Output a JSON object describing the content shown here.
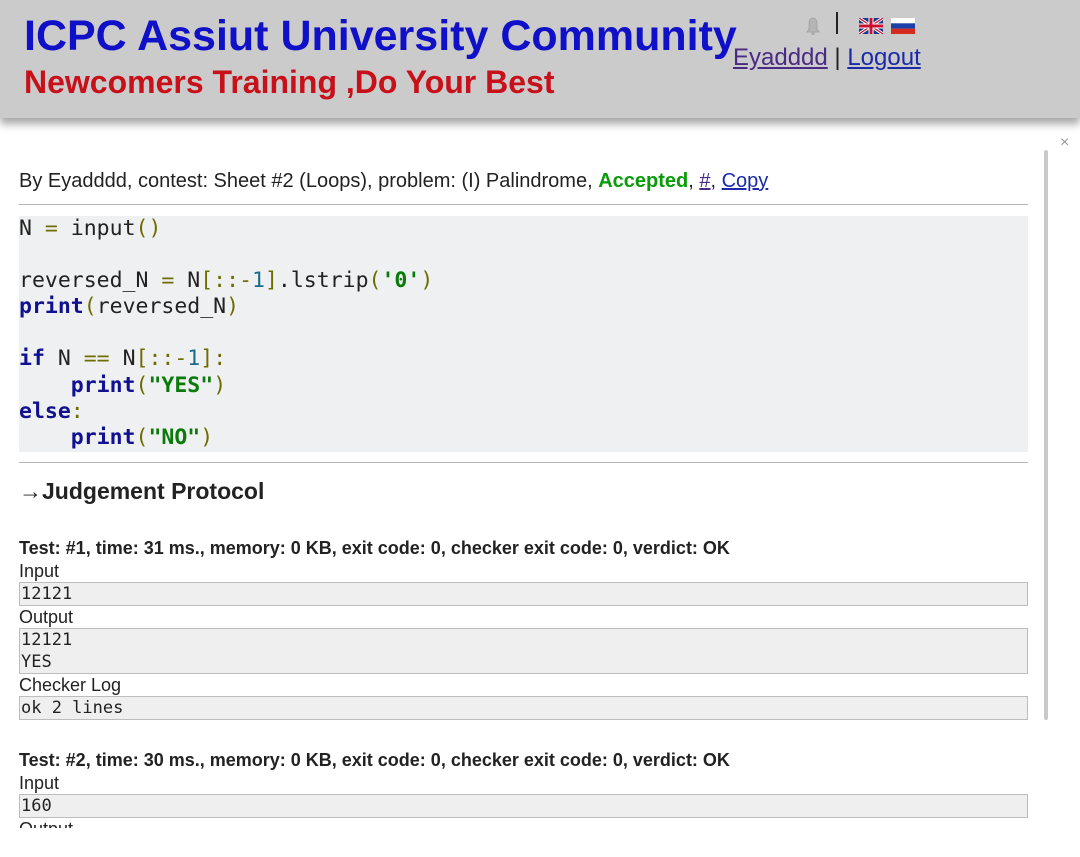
{
  "header": {
    "title": "ICPC Assiut University Community",
    "subtitle": "Newcomers Training ,Do Your Best",
    "username": "Eyadddd",
    "separator": "|",
    "logout": "Logout"
  },
  "icons": {
    "bell": "bell-icon",
    "lang_en": "uk-flag-icon",
    "lang_ru": "russia-flag-icon",
    "close": "close-icon"
  },
  "colors": {
    "title": "#1010c8",
    "subtitle": "#c8101a",
    "accepted": "#0a9a0a",
    "header_bg": "#cbcbcb",
    "code_bg": "#eff0f1"
  },
  "popup": {
    "close_glyph": "×",
    "submission": {
      "prefix": "By Eyadddd, contest: Sheet #2 (Loops), problem: (I) Palindrome, ",
      "verdict": "Accepted",
      "comma1": ", ",
      "hash_link": "#",
      "comma2": ", ",
      "copy_link": "Copy"
    },
    "judgement_title": "→Judgement Protocol",
    "tests": [
      {
        "header": "Test: #1, time: 31 ms., memory: 0 KB, exit code: 0, checker exit code: 0, verdict: OK",
        "input_label": "Input",
        "input": "12121",
        "output_label": "Output",
        "output_lines": [
          "12121",
          "YES"
        ],
        "checker_label": "Checker Log",
        "checker_log": "ok 2 lines"
      },
      {
        "header": "Test: #2, time: 30 ms., memory: 0 KB, exit code: 0, checker exit code: 0, verdict: OK",
        "input_label": "Input",
        "input": "160",
        "output_label": "Output"
      }
    ]
  }
}
